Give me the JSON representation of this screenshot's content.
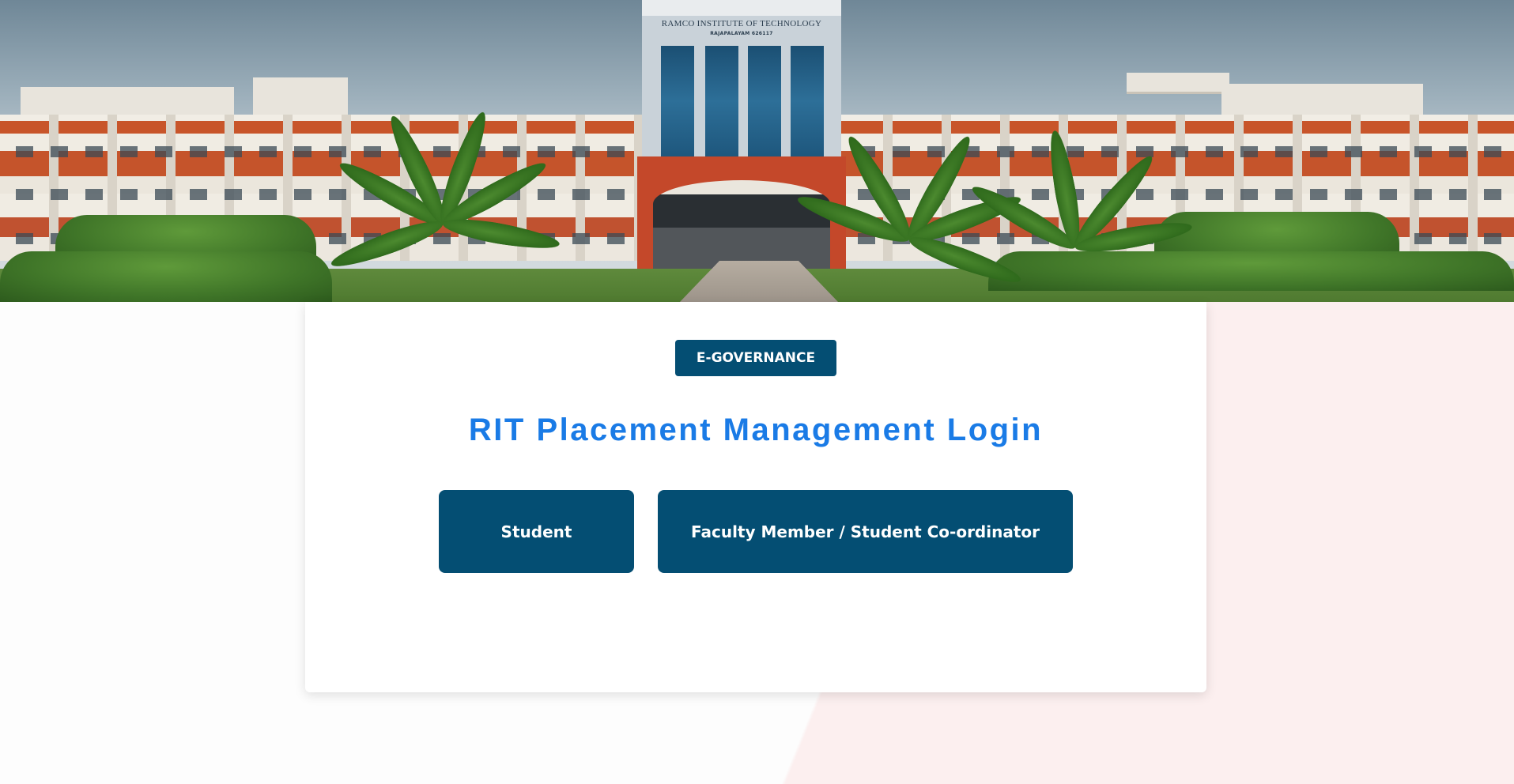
{
  "banner": {
    "alt": "campus-building-photo",
    "sign_line1": "RAMCO INSTITUTE OF TECHNOLOGY",
    "sign_line2": "RAJAPALAYAM    626117"
  },
  "card": {
    "badge_label": "E-GOVERNANCE",
    "title": "RIT Placement Management Login",
    "buttons": {
      "student": "Student",
      "faculty": "Faculty Member / Student Co-ordinator"
    }
  },
  "colors": {
    "primary": "#044e73",
    "title": "#1a7be6",
    "page_accent": "#fcefef"
  }
}
